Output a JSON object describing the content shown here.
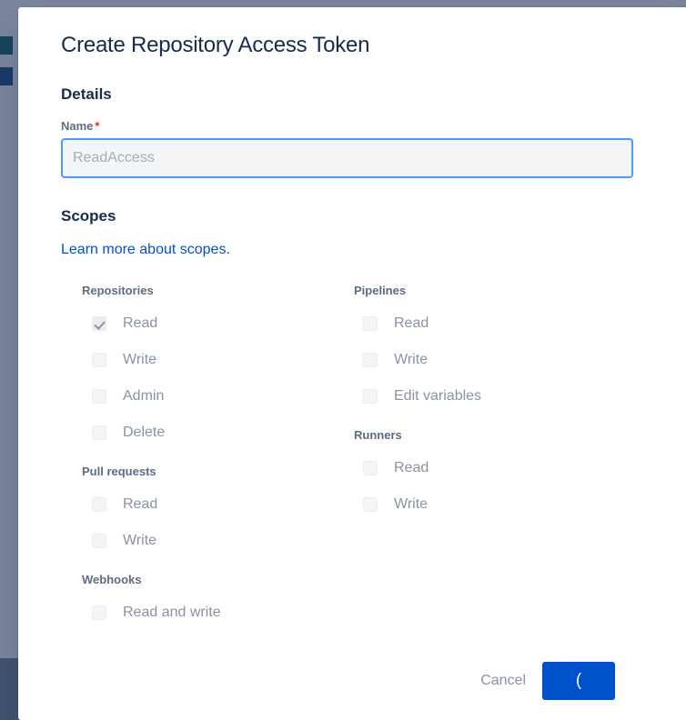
{
  "backdrop": {
    "color": "#7A849B",
    "bottom_panel_color": "#42526E",
    "icons": [
      "document-icon",
      "brand-logo-icon"
    ]
  },
  "dialog": {
    "title": "Create Repository Access Token",
    "details": {
      "heading": "Details",
      "name_label": "Name",
      "required_marker": "*",
      "name_value": "",
      "name_placeholder": "ReadAccess"
    },
    "scopes": {
      "heading": "Scopes",
      "link_text": "Learn more about scopes.",
      "link_color": "#0052CC",
      "columns": [
        {
          "side": "left",
          "groups": [
            {
              "title": "Repositories",
              "items": [
                {
                  "label": "Read",
                  "checked": true,
                  "disabled": true
                },
                {
                  "label": "Write",
                  "checked": false,
                  "disabled": true
                },
                {
                  "label": "Admin",
                  "checked": false,
                  "disabled": true
                },
                {
                  "label": "Delete",
                  "checked": false,
                  "disabled": true
                }
              ]
            },
            {
              "title": "Pull requests",
              "items": [
                {
                  "label": "Read",
                  "checked": false,
                  "disabled": true
                },
                {
                  "label": "Write",
                  "checked": false,
                  "disabled": true
                }
              ]
            },
            {
              "title": "Webhooks",
              "items": [
                {
                  "label": "Read and write",
                  "checked": false,
                  "disabled": true
                }
              ]
            }
          ]
        },
        {
          "side": "right",
          "groups": [
            {
              "title": "Pipelines",
              "items": [
                {
                  "label": "Read",
                  "checked": false,
                  "disabled": true
                },
                {
                  "label": "Write",
                  "checked": false,
                  "disabled": true
                },
                {
                  "label": "Edit variables",
                  "checked": false,
                  "disabled": true
                }
              ]
            },
            {
              "title": "Runners",
              "items": [
                {
                  "label": "Read",
                  "checked": false,
                  "disabled": true
                },
                {
                  "label": "Write",
                  "checked": false,
                  "disabled": true
                }
              ]
            }
          ]
        }
      ]
    },
    "footer": {
      "cancel_label": "Cancel",
      "submit_label": "(",
      "submit_color": "#0052CC"
    }
  }
}
